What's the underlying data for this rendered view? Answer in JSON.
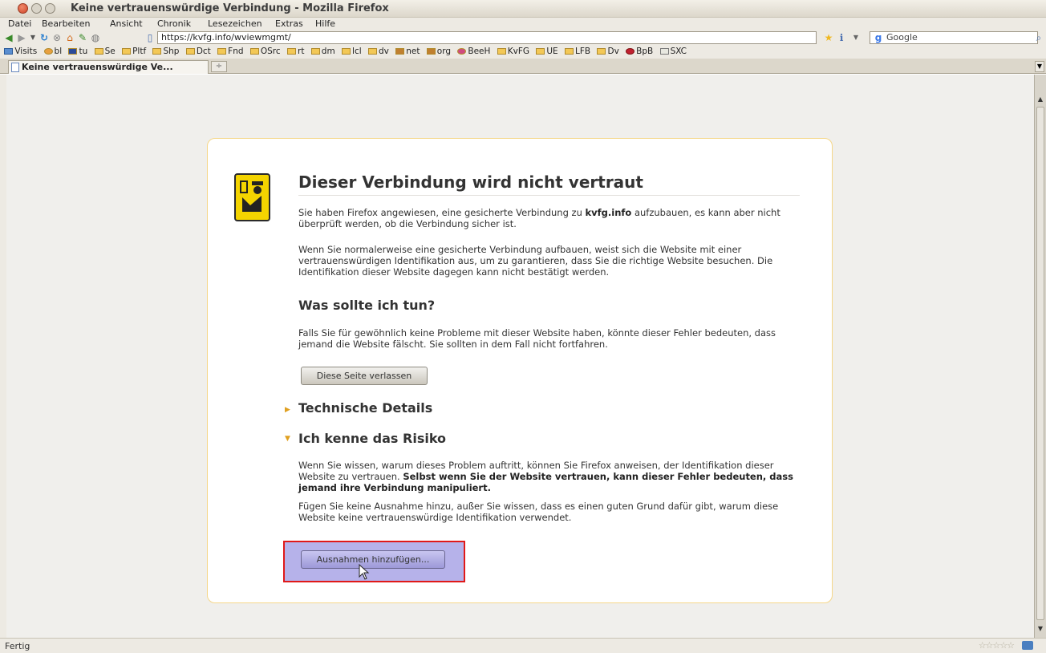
{
  "window": {
    "title": "Keine vertrauenswürdige Verbindung - Mozilla Firefox"
  },
  "menubar": {
    "items": [
      "Datei",
      "Bearbeiten",
      "Ansicht",
      "Chronik",
      "Lesezeichen",
      "Extras",
      "Hilfe"
    ]
  },
  "navbar": {
    "url": "https://kvfg.info/wviewmgmt/",
    "search_engine": "Google"
  },
  "bookmarks": [
    "Visits",
    "bl",
    "tu",
    "Se",
    "Pltf",
    "Shp",
    "Dct",
    "Fnd",
    "OSrc",
    "rt",
    "dm",
    "lcl",
    "dv",
    "net",
    "org",
    "BeeH",
    "KvFG",
    "UE",
    "LFB",
    "Dv",
    "BpB",
    "SXC"
  ],
  "tab": {
    "title": "Keine vertrauenswürdige Ve...",
    "close_glyph": "÷"
  },
  "error_page": {
    "title": "Dieser Verbindung wird nicht vertraut",
    "intro_pre": "Sie haben Firefox angewiesen, eine gesicherte Verbindung zu ",
    "intro_domain": "kvfg.info",
    "intro_post": " aufzubauen, es kann aber nicht überprüft werden, ob die Verbindung sicher ist.",
    "explanation": "Wenn Sie normalerweise eine gesicherte Verbindung aufbauen, weist sich die Website mit einer vertrauenswürdigen Identifikation aus, um zu garantieren, dass Sie die richtige Website besuchen. Die Identifikation dieser Website dagegen kann nicht bestätigt werden.",
    "what_title": "Was sollte ich tun?",
    "what_text": "Falls Sie für gewöhnlich keine Probleme mit dieser Website haben, könnte dieser Fehler bedeuten, dass jemand die Website fälscht. Sie sollten in dem Fall nicht fortfahren.",
    "leave_button": "Diese Seite verlassen",
    "tech_title": "Technische Details",
    "risk_title": "Ich kenne das Risiko",
    "risk_text_pre": "Wenn Sie wissen, warum dieses Problem auftritt, können Sie Firefox anweisen, der Identifikation dieser Website zu vertrauen. ",
    "risk_text_bold": "Selbst wenn Sie der Website vertrauen, kann dieser Fehler bedeuten, dass jemand ihre Verbindung manipuliert.",
    "risk_text2": "Fügen Sie keine Ausnahme hinzu, außer Sie wissen, dass es einen guten Grund dafür gibt, warum diese Website keine vertrauenswürdige Identifikation verwendet.",
    "add_exception_button": "Ausnahmen hinzufügen..."
  },
  "statusbar": {
    "text": "Fertig",
    "rating": "☆☆☆☆☆"
  },
  "colors": {
    "highlight_border": "#e01919",
    "highlight_fill": "#b6b2ea",
    "warning_yellow": "#f4d400"
  }
}
